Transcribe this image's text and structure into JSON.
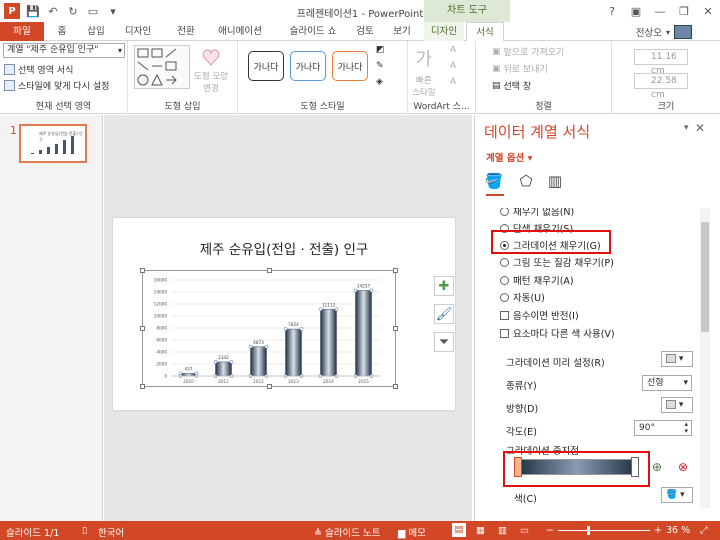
{
  "window": {
    "title": "프레젠테이션1 - PowerPoint",
    "context_tab_group": "차트 도구"
  },
  "tabs": [
    {
      "label": "파일"
    },
    {
      "label": "홈"
    },
    {
      "label": "삽입"
    },
    {
      "label": "디자인"
    },
    {
      "label": "전환"
    },
    {
      "label": "애니메이션"
    },
    {
      "label": "슬라이드 쇼"
    },
    {
      "label": "검토"
    },
    {
      "label": "보기"
    },
    {
      "label": "디자인"
    },
    {
      "label": "서식"
    }
  ],
  "user": {
    "name": "전상오"
  },
  "ribbon": {
    "current_selection": {
      "dropdown_value": "계열 \"제주 순유입 인구\"",
      "format_selection": "선택 영역 서식",
      "reset_style": "스타일에 맞게 다시 설정",
      "label": "현재 선택 영역"
    },
    "insert_shapes": {
      "change_shape": "도형 모양\n변경",
      "label": "도형 삽입"
    },
    "shape_styles": {
      "style_text": "가나다",
      "label": "도형 스타일"
    },
    "wordart": {
      "quick_styles": "빠른\n스타일",
      "label": "WordArt 스..."
    },
    "arrange": {
      "bring_forward": "앞으로 가져오기",
      "send_backward": "뒤로 보내기",
      "selection_pane": "선택 창",
      "label": "정렬"
    },
    "size": {
      "height": "11.16 cm",
      "width": "22.58 cm",
      "label": "크기"
    }
  },
  "thumbnail": {
    "number": "1",
    "title": "제주 순유입(전입·전출) 인구"
  },
  "slide": {
    "title": "제주 순유입(전입 · 전출) 인구"
  },
  "chart_data": {
    "type": "bar",
    "title": "제주 순유입(전입 · 전출) 인구",
    "categories": [
      "2010",
      "2011",
      "2012",
      "2013",
      "2014",
      "2015"
    ],
    "series": [
      {
        "name": "제주 순유입 인구",
        "values": [
          437,
          2342,
          4873,
          7824,
          11112,
          14257
        ]
      }
    ],
    "data_labels": [
      "437",
      "2342",
      "4873",
      "7824",
      "11112",
      "14257"
    ],
    "ylim": [
      0,
      16000
    ],
    "yticks": [
      "0",
      "2000",
      "4000",
      "6000",
      "8000",
      "10000",
      "12000",
      "14000",
      "16000"
    ],
    "grid": true,
    "fill": "gradient",
    "colors": {
      "dark": "#1f2e42",
      "light": "#d9e1ea"
    }
  },
  "taskpane": {
    "title": "데이터 계열 서식",
    "options_label": "계열 옵션",
    "fill_options": [
      {
        "label": "채우기 없음(N)",
        "selected": false
      },
      {
        "label": "단색 채우기(S)",
        "selected": false
      },
      {
        "label": "그라데이션 채우기(G)",
        "selected": true
      },
      {
        "label": "그림 또는 질감 채우기(P)",
        "selected": false
      },
      {
        "label": "패턴 채우기(A)",
        "selected": false
      },
      {
        "label": "자동(U)",
        "selected": false
      }
    ],
    "invert_if_negative": "음수이면 반전(I)",
    "vary_colors": "요소마다 다른 색 사용(V)",
    "preset_gradient": "그라데이션 미리 설정(R)",
    "type_label": "종류(Y)",
    "type_value": "선형",
    "direction_label": "방향(D)",
    "angle_label": "각도(E)",
    "angle_value": "90°",
    "stops_label": "그라데이션 중지점",
    "color_label": "색(C)"
  },
  "statusbar": {
    "slide": "슬라이드 1/1",
    "language": "한국어",
    "notes": "슬라이드 노트",
    "comments": "메모",
    "zoom": "36 %"
  },
  "accent": "#d24726"
}
